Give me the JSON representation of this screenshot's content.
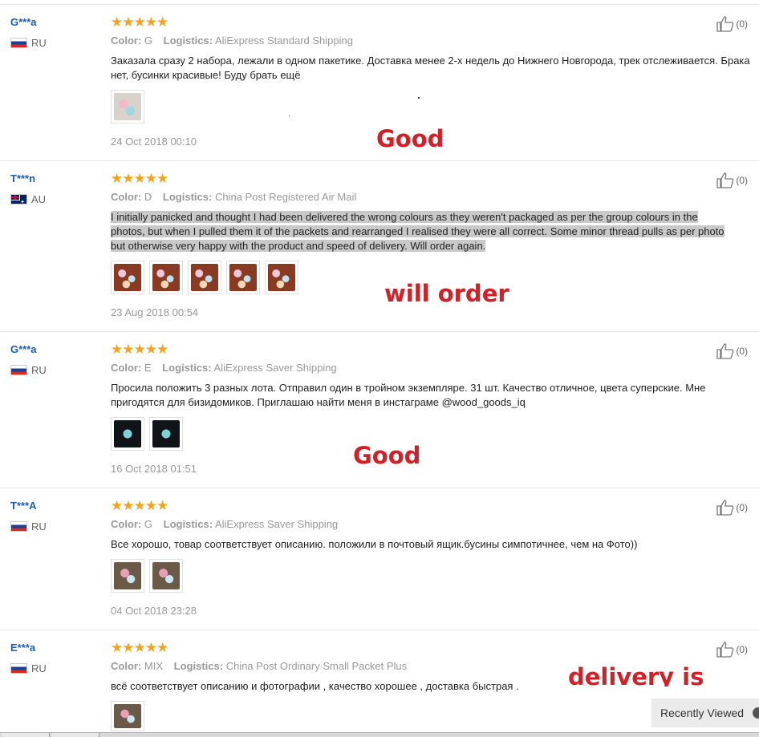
{
  "reviews": [
    {
      "user": "G***a",
      "country": "RU",
      "stars": "★★★★★",
      "color_label": "Color:",
      "color": "G",
      "logistics_label": "Logistics:",
      "logistics": "AliExpress Standard Shipping",
      "text": "Заказала сразу 2 набора, лежали в одном пакетике. Доставка менее 2-х недель до Нижнего Новгорода, трек отслеживается. Брака нет, бусинки красивые! Буду брать ещё",
      "date": "24 Oct 2018 00:10",
      "likes": "(0)",
      "photos": 1
    },
    {
      "user": "T***n",
      "country": "AU",
      "stars": "★★★★★",
      "color_label": "Color:",
      "color": "D",
      "logistics_label": "Logistics:",
      "logistics": "China Post Registered Air Mail",
      "text": "I initially panicked and thought I had been delivered the wrong colours as they weren't packaged as per the group colours in the photos, but when I pulled them it of the packets and rearranged I realised they were all correct. Some minor thread pulls as per photo but otherwise very happy with the product and speed of delivery. Will order again.",
      "date": "23 Aug 2018 00:54",
      "likes": "(0)",
      "photos": 5
    },
    {
      "user": "G***a",
      "country": "RU",
      "stars": "★★★★★",
      "color_label": "Color:",
      "color": "E",
      "logistics_label": "Logistics:",
      "logistics": "AliExpress Saver Shipping",
      "text": "Просила положить 3 разных лота. Отправил один в тройном экземпляре. 31 шт. Качество отличное, цвета суперские. Мне пригодятся для бизидомиков. Приглашаю найти меня в инстаграме @wood_goods_iq",
      "date": "16 Oct 2018 01:51",
      "likes": "(0)",
      "photos": 2
    },
    {
      "user": "T***A",
      "country": "RU",
      "stars": "★★★★★",
      "color_label": "Color:",
      "color": "G",
      "logistics_label": "Logistics:",
      "logistics": "AliExpress Saver Shipping",
      "text": "Все хорошо, товар соответствует описанию. положили в почтовый ящик.бусины симпотичнее, чем на Фото))",
      "date": "04 Oct 2018 23:28",
      "likes": "(0)",
      "photos": 2
    },
    {
      "user": "E***a",
      "country": "RU",
      "stars": "★★★★★",
      "color_label": "Color:",
      "color": "MIX",
      "logistics_label": "Logistics:",
      "logistics": "China Post Ordinary Small Packet Plus",
      "text": "всё соответствует описанию и фотографии , качество хорошее , доставка быстрая .",
      "likes": "(0)",
      "photos": 1
    }
  ],
  "overlays": [
    "Good product",
    "will order again",
    "Good quality",
    "delivery is fast."
  ],
  "recently_viewed": "Recently Viewed",
  "colors": {
    "stars": "#f7a21b",
    "username": "#1a5fb4",
    "overlay_text": "#d32027"
  }
}
